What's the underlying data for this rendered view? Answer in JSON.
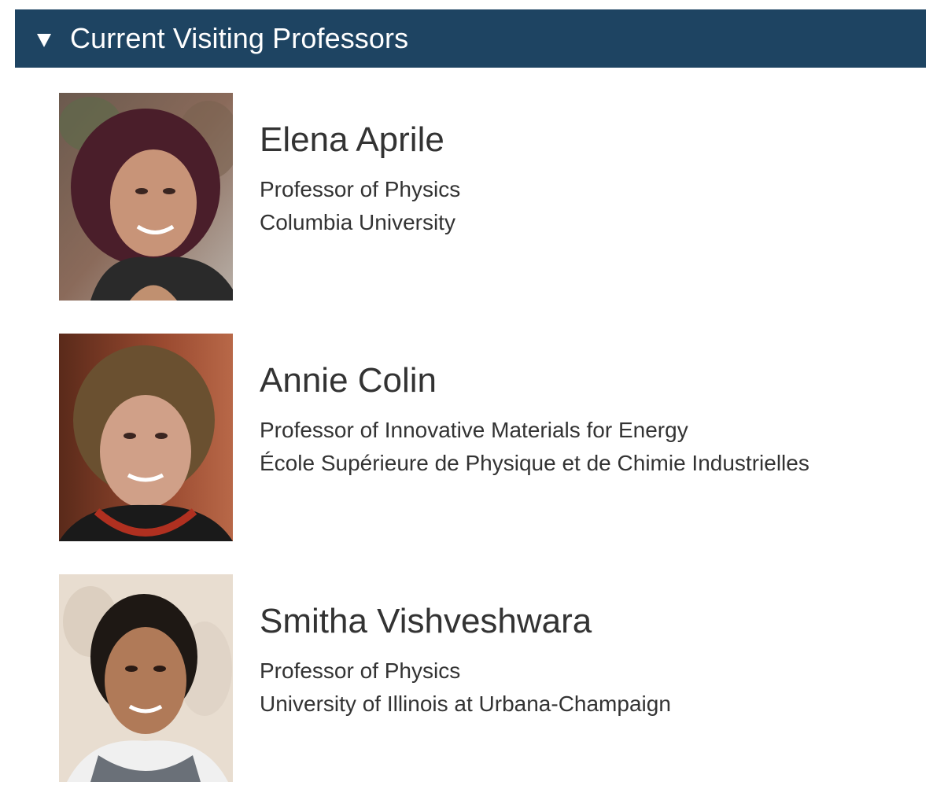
{
  "section": {
    "title": "Current Visiting Professors",
    "toggle_icon": "triangle-down-icon",
    "header_color": "#1e4462"
  },
  "professors": [
    {
      "name": "Elena Aprile",
      "title": "Professor of Physics",
      "institution": "Columbia University"
    },
    {
      "name": "Annie Colin",
      "title": "Professor of Innovative Materials for Energy",
      "institution": "École Supérieure de Physique et de Chimie Industrielles"
    },
    {
      "name": "Smitha Vishveshwara",
      "title": "Professor of Physics",
      "institution": "University of Illinois at Urbana-Champaign"
    }
  ]
}
